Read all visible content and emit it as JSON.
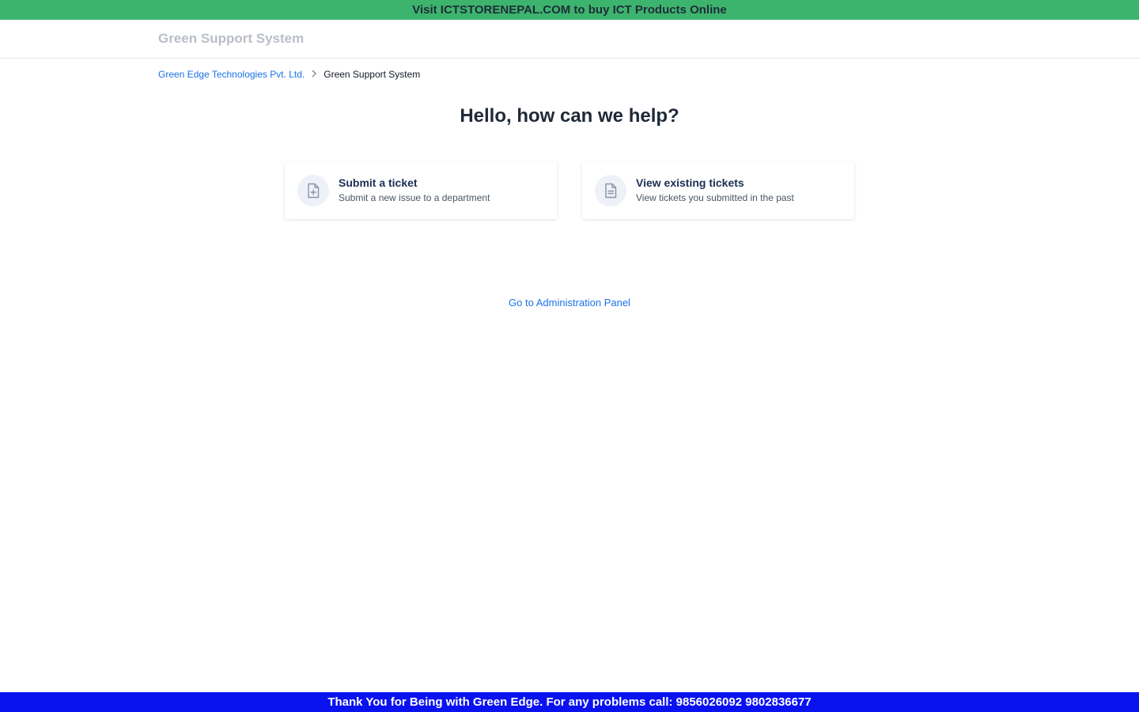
{
  "top_banner": {
    "text": "Visit ICTSTORENEPAL.COM to buy ICT Products Online",
    "bg_color": "#3db46d"
  },
  "header": {
    "brand": "Green Support System"
  },
  "breadcrumb": {
    "items": [
      {
        "label": "Green Edge Technologies Pvt. Ltd."
      },
      {
        "label": "Green Support System"
      }
    ],
    "separator_icon": "chevron-right-icon"
  },
  "main": {
    "title": "Hello, how can we help?",
    "cards": [
      {
        "title": "Submit a ticket",
        "subtitle": "Submit a new issue to a department",
        "icon": "file-plus-icon"
      },
      {
        "title": "View existing tickets",
        "subtitle": "View tickets you submitted in the past",
        "icon": "file-text-icon"
      }
    ],
    "admin_link": "Go to Administration Panel"
  },
  "footer_banner": {
    "text": "Thank You for Being with Green Edge. For any problems call: 9856026092 9802836677",
    "bg_color": "#0a12f0"
  },
  "colors": {
    "link": "#1a73e8",
    "card_title": "#1b2f55",
    "brand_muted": "#b9bec7"
  }
}
